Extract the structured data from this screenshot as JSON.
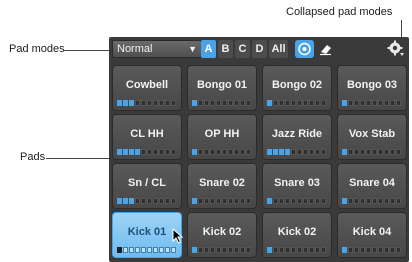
{
  "callouts": {
    "collapsed": "Collapsed pad modes",
    "pad_modes": "Pad modes",
    "pads": "Pads"
  },
  "toolbar": {
    "mode_value": "Normal",
    "banks": [
      "A",
      "B",
      "C",
      "D",
      "All"
    ],
    "active_bank": "A"
  },
  "pads": [
    {
      "label": "Cowbell",
      "level": 3
    },
    {
      "label": "Bongo 01",
      "level": 1
    },
    {
      "label": "Bongo 02",
      "level": 1
    },
    {
      "label": "Bongo 03",
      "level": 1
    },
    {
      "label": "CL HH",
      "level": 4
    },
    {
      "label": "OP HH",
      "level": 1
    },
    {
      "label": "Jazz Ride",
      "level": 4
    },
    {
      "label": "Vox Stab",
      "level": 1
    },
    {
      "label": "Sn / CL",
      "level": 3
    },
    {
      "label": "Snare 02",
      "level": 1
    },
    {
      "label": "Snare 03",
      "level": 1
    },
    {
      "label": "Snare 04",
      "level": 1
    },
    {
      "label": "Kick 01",
      "level": 1,
      "selected": true
    },
    {
      "label": "Kick 02",
      "level": 1
    },
    {
      "label": "Kick 02",
      "level": 1
    },
    {
      "label": "Kick 04",
      "level": 1
    }
  ],
  "colors": {
    "accent": "#4aa3e6",
    "panel": "#3a3a3a",
    "pad": "#4f4f4f"
  }
}
